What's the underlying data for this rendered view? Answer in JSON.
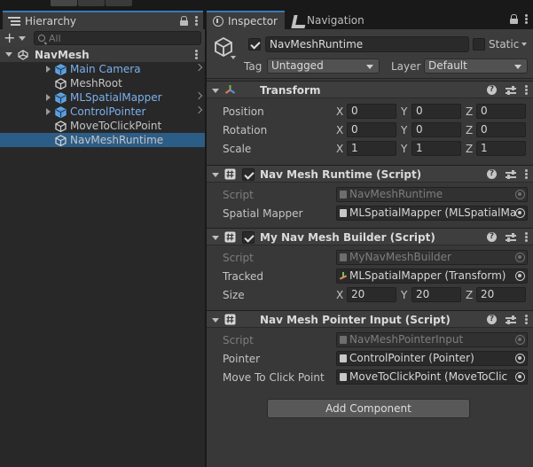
{
  "hierarchy": {
    "tab_label": "Hierarchy",
    "search_placeholder": "All",
    "scene": "NavMesh",
    "items": [
      {
        "label": "Main Camera",
        "prefab": true,
        "foldout": true,
        "chevron": true
      },
      {
        "label": "MeshRoot",
        "prefab": false,
        "foldout": false,
        "chevron": false
      },
      {
        "label": "MLSpatialMapper",
        "prefab": true,
        "foldout": true,
        "chevron": true
      },
      {
        "label": "ControlPointer",
        "prefab": true,
        "foldout": true,
        "chevron": true
      },
      {
        "label": "MoveToClickPoint",
        "prefab": false,
        "foldout": false,
        "chevron": false
      },
      {
        "label": "NavMeshRuntime",
        "prefab": false,
        "foldout": false,
        "chevron": false,
        "selected": true
      }
    ]
  },
  "inspector": {
    "tab_label": "Inspector",
    "nav_tab_label": "Navigation",
    "object_name": "NavMeshRuntime",
    "static_label": "Static",
    "tag_label": "Tag",
    "tag_value": "Untagged",
    "layer_label": "Layer",
    "layer_value": "Default",
    "transform": {
      "title": "Transform",
      "position_label": "Position",
      "rotation_label": "Rotation",
      "scale_label": "Scale",
      "position": {
        "x": "0",
        "y": "0",
        "z": "0"
      },
      "rotation": {
        "x": "0",
        "y": "0",
        "z": "0"
      },
      "scale": {
        "x": "1",
        "y": "1",
        "z": "1"
      }
    },
    "axis": {
      "x": "X",
      "y": "Y",
      "z": "Z"
    },
    "nav_mesh_runtime": {
      "title": "Nav Mesh Runtime (Script)",
      "script_label": "Script",
      "script_value": "NavMeshRuntime",
      "spatial_mapper_label": "Spatial Mapper",
      "spatial_mapper_value": "MLSpatialMapper (MLSpatialMa"
    },
    "my_nav_mesh_builder": {
      "title": "My Nav Mesh Builder (Script)",
      "script_label": "Script",
      "script_value": "MyNavMeshBuilder",
      "tracked_label": "Tracked",
      "tracked_value": "MLSpatialMapper (Transform)",
      "size_label": "Size",
      "size": {
        "x": "20",
        "y": "20",
        "z": "20"
      }
    },
    "nav_mesh_pointer_input": {
      "title": "Nav Mesh Pointer Input (Script)",
      "script_label": "Script",
      "script_value": "NavMeshPointerInput",
      "pointer_label": "Pointer",
      "pointer_value": "ControlPointer (Pointer)",
      "move_label": "Move To Click Point",
      "move_value": "MoveToClickPoint (MoveToClic"
    },
    "add_component_label": "Add Component"
  },
  "colors": {
    "selection": "#2c5d87",
    "prefab_text": "#7bb0ee",
    "tab_accent": "#3a79bb",
    "panel_bg": "#383838"
  }
}
